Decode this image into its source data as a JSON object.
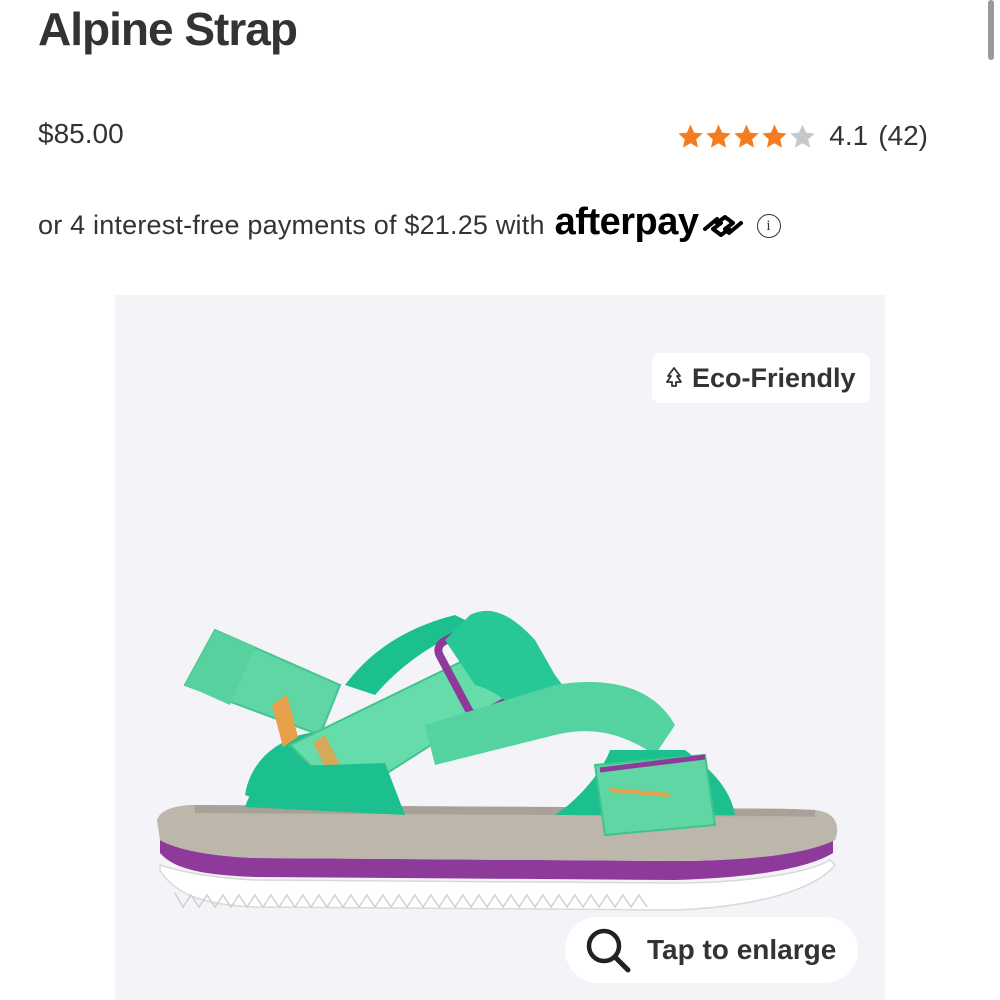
{
  "product": {
    "title": "Alpine Strap",
    "price": "$85.00"
  },
  "rating": {
    "stars_value": 4.1,
    "value_text": "4.1",
    "count_text": "(42)",
    "star_color": "#f47c20",
    "empty_star_color": "#c8c8c8"
  },
  "afterpay": {
    "text": "or 4 interest-free payments of $21.25 with",
    "logo": "afterpay",
    "info_icon": "info-icon",
    "info_glyph": "i"
  },
  "image": {
    "badge_label": "Eco-Friendly",
    "badge_icon": "tree-icon",
    "enlarge_label": "Tap to enlarge",
    "enlarge_icon": "search-icon",
    "background": "#f4f4f8",
    "sandal_colors": {
      "strap": "#5fd6a4",
      "strap_dark": "#1cc08e",
      "accent": "#8e3a9b",
      "sole": "#b9b3a8",
      "outsole": "#ffffff"
    }
  }
}
